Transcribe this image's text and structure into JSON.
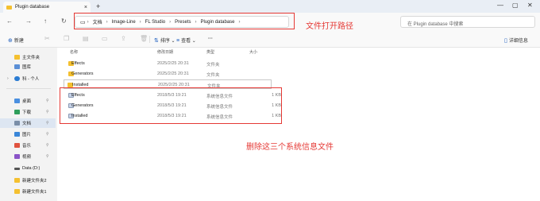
{
  "window": {
    "tab_title": "Plugin database",
    "new_tab": "+",
    "controls": [
      "—",
      "▢",
      "✕"
    ]
  },
  "nav": {
    "back": "←",
    "forward": "→",
    "up": "↑",
    "refresh": "↻"
  },
  "breadcrumb": {
    "items": [
      "文档",
      "Image-Line",
      "FL Studio",
      "Presets",
      "Plugin database"
    ],
    "separator": "›"
  },
  "search": {
    "placeholder": "在 Plugin database 中搜索"
  },
  "toolbar": {
    "new_label": "新建",
    "sort_label": "排序",
    "view_label": "查看",
    "more_label": "···",
    "details_label": "详细信息"
  },
  "sidebar": {
    "items": [
      {
        "label": "主文件夹",
        "icon": "home-icon"
      },
      {
        "label": "图库",
        "icon": "gallery-icon"
      },
      {
        "label": "科 - 个人",
        "icon": "onedrive-icon"
      },
      {
        "label": "桌面",
        "icon": "desktop-icon"
      },
      {
        "label": "下载",
        "icon": "download-icon"
      },
      {
        "label": "文档",
        "icon": "documents-icon"
      },
      {
        "label": "图片",
        "icon": "pictures-icon"
      },
      {
        "label": "音乐",
        "icon": "music-icon"
      },
      {
        "label": "视频",
        "icon": "video-icon"
      },
      {
        "label": "Data (D:)",
        "icon": "drive-icon"
      },
      {
        "label": "新建文件夹2",
        "icon": "folder-icon"
      },
      {
        "label": "新建文件夹1",
        "icon": "folder-icon"
      }
    ]
  },
  "columns": {
    "name": "名称",
    "date": "修改日期",
    "type": "类型",
    "size": "大小"
  },
  "files": [
    {
      "name": "Effects",
      "date": "2025/2/25 20:31",
      "type": "文件夹",
      "size": "",
      "kind": "folder"
    },
    {
      "name": "Generators",
      "date": "2025/2/25 20:31",
      "type": "文件夹",
      "size": "",
      "kind": "folder"
    },
    {
      "name": "Installed",
      "date": "2025/2/25 20:31",
      "type": "文件夹",
      "size": "",
      "kind": "folder"
    },
    {
      "name": "Effects",
      "date": "2018/5/3 19:21",
      "type": "系统信息文件",
      "size": "1 KB",
      "kind": "sysinfo"
    },
    {
      "name": "Generators",
      "date": "2018/5/3 19:21",
      "type": "系统信息文件",
      "size": "1 KB",
      "kind": "sysinfo"
    },
    {
      "name": "Installed",
      "date": "2018/5/3 19:21",
      "type": "系统信息文件",
      "size": "1 KB",
      "kind": "sysinfo"
    }
  ],
  "annotations": {
    "path_note": "文件打开路径",
    "delete_note": "删除这三个系统信息文件",
    "color": "#e53935"
  }
}
